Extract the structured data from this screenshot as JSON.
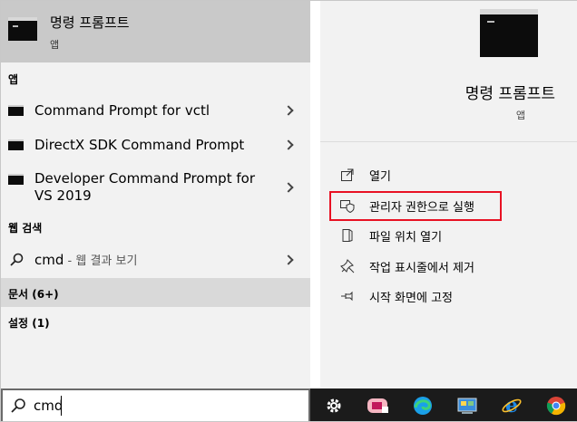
{
  "best_match": {
    "title": "명령 프롬프트",
    "type": "앱"
  },
  "apps_header": "앱",
  "apps": [
    {
      "label": "Command Prompt for vctl"
    },
    {
      "label": "DirectX SDK Command Prompt"
    },
    {
      "label_line1": "Developer Command Prompt for",
      "label_line2": "VS 2019"
    }
  ],
  "web_header": "웹 검색",
  "web_result": {
    "query": "cmd",
    "suffix": " - 웹 결과 보기"
  },
  "documents": "문서 (6+)",
  "settings": "설정 (1)",
  "detail": {
    "title": "명령 프롬프트",
    "type": "앱"
  },
  "actions": {
    "open": "열기",
    "run_as_admin": "관리자 권한으로 실행",
    "open_location": "파일 위치 열기",
    "unpin_start": "작업 표시줄에서 제거",
    "pin_start": "시작 화면에 고정"
  },
  "search": {
    "value": "cmd"
  },
  "taskbar_icons": [
    "gear-icon",
    "photo-app-icon",
    "edge-icon",
    "control-panel-icon",
    "internet-explorer-icon",
    "chrome-icon"
  ],
  "colors": {
    "highlight": "#e81123",
    "taskbar": "#1b1b1b"
  }
}
